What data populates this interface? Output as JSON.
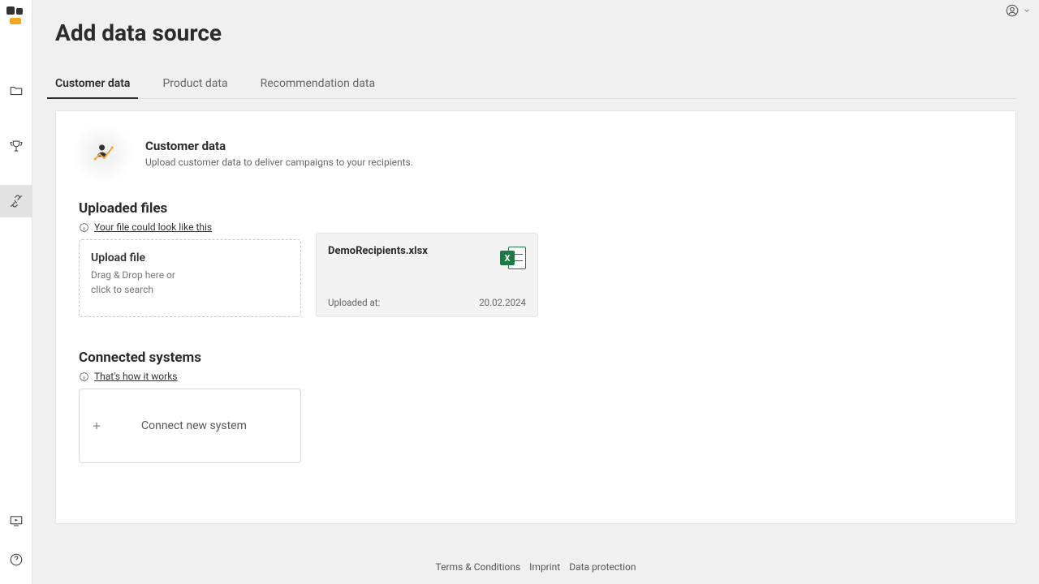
{
  "page": {
    "title": "Add data source"
  },
  "tabs": [
    {
      "label": "Customer data",
      "active": true
    },
    {
      "label": "Product data",
      "active": false
    },
    {
      "label": "Recommendation data",
      "active": false
    }
  ],
  "intro": {
    "heading": "Customer data",
    "subtext": "Upload customer data to deliver campaigns to your recipients."
  },
  "uploaded": {
    "heading": "Uploaded files",
    "hint_link": "Your file could look like this",
    "upload_card": {
      "title": "Upload file",
      "line1": "Drag & Drop here or",
      "line2": "click to search"
    },
    "files": [
      {
        "name": "DemoRecipients.xlsx",
        "uploaded_label": "Uploaded at:",
        "uploaded_date": "20.02.2024",
        "icon_letter": "X"
      }
    ]
  },
  "connected": {
    "heading": "Connected systems",
    "hint_link": "That's how it works",
    "connect_label": "Connect new system"
  },
  "footer": {
    "terms": "Terms & Conditions",
    "imprint": "Imprint",
    "data_protection": "Data protection"
  },
  "sidebar": {
    "items": [
      {
        "name": "folder",
        "active": false
      },
      {
        "name": "campaigns",
        "active": false
      },
      {
        "name": "data-sources",
        "active": true
      }
    ],
    "bottom": [
      {
        "name": "video-help"
      },
      {
        "name": "help"
      }
    ]
  }
}
